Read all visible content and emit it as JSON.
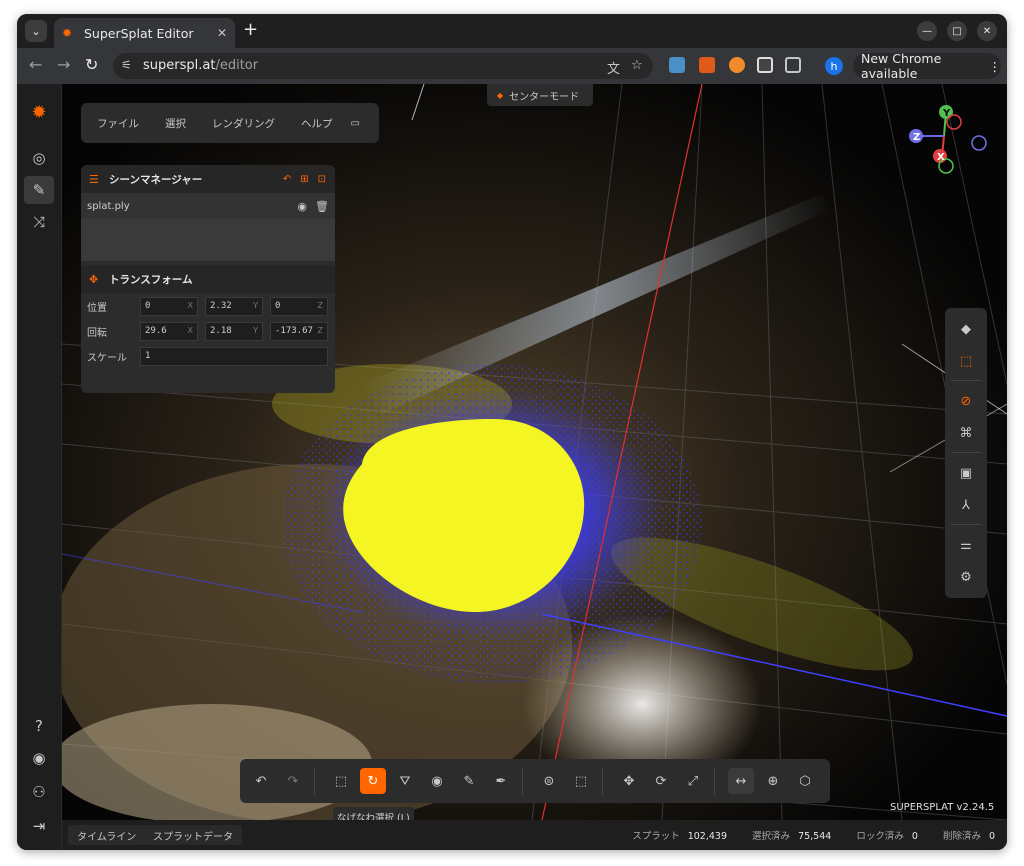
{
  "browser": {
    "tab_title": "SuperSplat Editor",
    "url_host": "superspl.at",
    "url_path": "/editor",
    "profile_initial": "h",
    "update_label": "New Chrome available"
  },
  "app": {
    "menu": {
      "items": [
        "ファイル",
        "選択",
        "レンダリング",
        "ヘルプ"
      ]
    },
    "center_mode": "センターモード",
    "scene_manager": {
      "title": "シーンマネージャー",
      "splat_name": "splat.ply"
    },
    "transform": {
      "title": "トランスフォーム",
      "position_label": "位置",
      "rotation_label": "回転",
      "scale_label": "スケール",
      "position": {
        "x": "0",
        "y": "2.32",
        "z": "0"
      },
      "rotation": {
        "x": "29.6",
        "y": "2.18",
        "z": "-173.67"
      },
      "scale": "1",
      "axis_x": "X",
      "axis_y": "Y",
      "axis_z": "Z"
    },
    "gizmo": {
      "x": "X",
      "y": "Y",
      "z": "Z"
    },
    "tooltip": "なげなわ選択 (L)",
    "version": "SUPERSPLAT v2.24.5",
    "status": {
      "timeline_tab": "タイムライン",
      "splat_data_tab": "スプラットデータ",
      "splats_label": "スプラット",
      "splats_value": "102,439",
      "selected_label": "選択済み",
      "selected_value": "75,544",
      "locked_label": "ロック済み",
      "locked_value": "0",
      "deleted_label": "削除済み",
      "deleted_value": "0"
    }
  },
  "colors": {
    "accent": "#ff6600",
    "selection": "#f5f523",
    "point_blue": "#2a2af0"
  }
}
